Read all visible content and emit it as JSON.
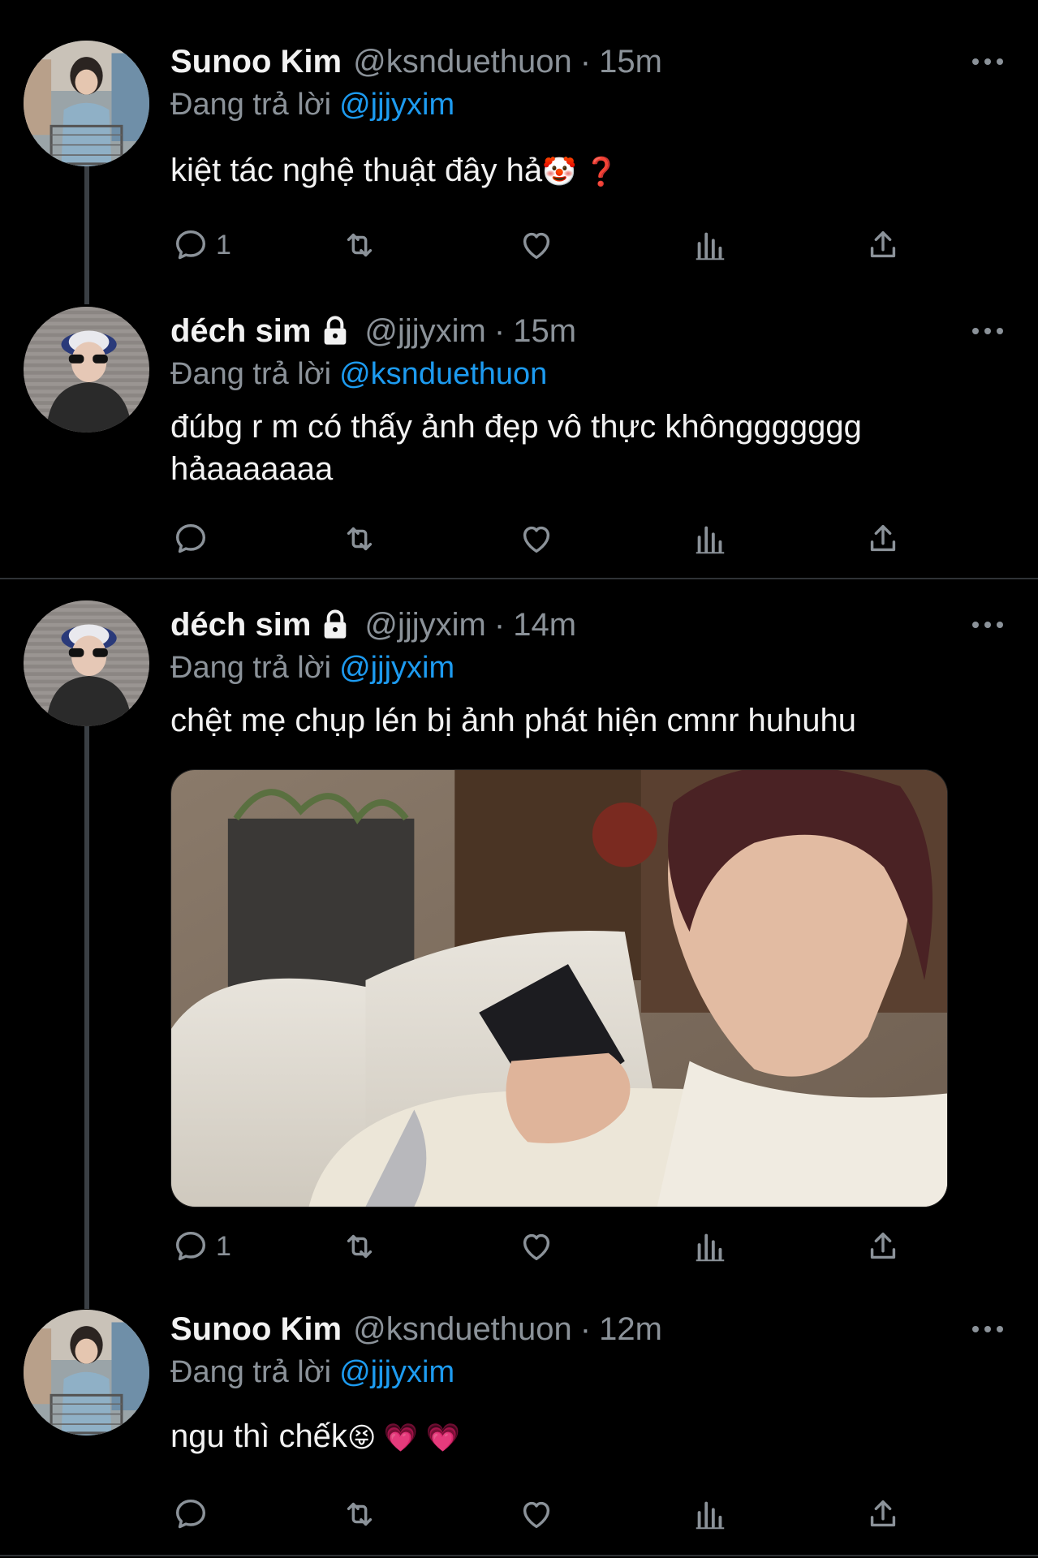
{
  "tweets": [
    {
      "name": "Sunoo Kim",
      "handle": "@ksnduethuon",
      "sep": "·",
      "time": "15m",
      "reply_prefix": "Đang trả lời",
      "reply_to": "@jjjyxim",
      "text": "kiệt tác nghệ thuật đây hả",
      "emoji": "🤡 ❓",
      "reply_count": "1",
      "avatar": "sunoo-avatar"
    },
    {
      "name": "déch sim",
      "locked": true,
      "handle": "@jjjyxim",
      "sep": "·",
      "time": "15m",
      "reply_prefix": "Đang trả lời",
      "reply_to": "@ksnduethuon",
      "text": "đúbg r m có thấy ảnh đẹp vô thực khônggggggg hảaaaaaaa",
      "reply_count": "",
      "avatar": "dech-avatar"
    },
    {
      "name": "déch sim",
      "locked": true,
      "handle": "@jjjyxim",
      "sep": "·",
      "time": "14m",
      "reply_prefix": "Đang trả lời",
      "reply_to": "@jjjyxim",
      "text": "chệt mẹ chụp lén bị ảnh phát hiện cmnr huhuhu",
      "reply_count": "1",
      "avatar": "dech-avatar",
      "media": "photo-person-on-couch-holding-phone"
    },
    {
      "name": "Sunoo Kim",
      "handle": "@ksnduethuon",
      "sep": "·",
      "time": "12m",
      "reply_prefix": "Đang trả lời",
      "reply_to": "@jjjyxim",
      "text": "ngu thì chếk",
      "emoji": "😝 💗 💗",
      "reply_count": "",
      "avatar": "sunoo-avatar"
    }
  ],
  "icons": {
    "reply": "reply-icon",
    "retweet": "retweet-icon",
    "like": "heart-icon",
    "views": "views-icon",
    "share": "share-icon",
    "more": "more-icon",
    "lock": "lock-icon"
  },
  "colors": {
    "background": "#000000",
    "text": "#e7e9ea",
    "muted": "#8b9299",
    "accent": "#1d9bf0",
    "divider": "#2f3336"
  }
}
